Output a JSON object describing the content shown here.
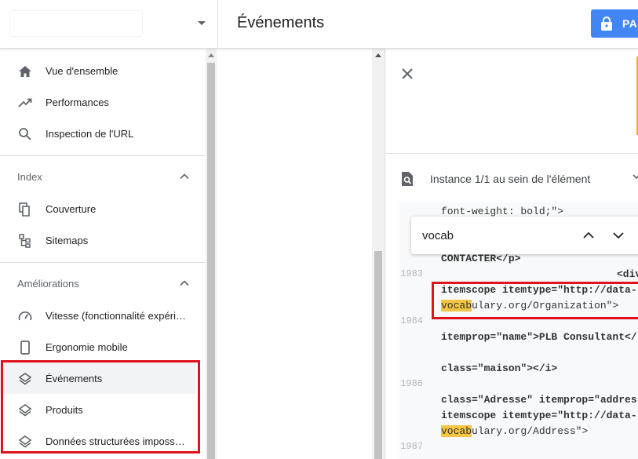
{
  "header": {
    "property_selector_value": "",
    "title": "Événements",
    "premium_label": "PA"
  },
  "sidebar": {
    "items_top": [
      {
        "label": "Vue d'ensemble",
        "icon": "home-icon"
      },
      {
        "label": "Performances",
        "icon": "trending-up-icon"
      },
      {
        "label": "Inspection de l'URL",
        "icon": "search-icon"
      }
    ],
    "sections": [
      {
        "title": "Index",
        "items": [
          {
            "label": "Couverture",
            "icon": "copy-icon"
          },
          {
            "label": "Sitemaps",
            "icon": "sitemap-icon"
          }
        ]
      },
      {
        "title": "Améliorations",
        "items": [
          {
            "label": "Vitesse (fonctionnalité expérimentale)",
            "icon": "speed-icon"
          },
          {
            "label": "Ergonomie mobile",
            "icon": "phone-icon"
          },
          {
            "label": "Événements",
            "icon": "layers-icon",
            "active": true
          },
          {
            "label": "Produits",
            "icon": "layers-icon"
          },
          {
            "label": "Données structurées impossibles à analyser",
            "icon": "layers-icon"
          }
        ]
      }
    ]
  },
  "detail": {
    "instance_text": "Instance 1/1 au sein de l'élément",
    "search": {
      "value": "vocab"
    },
    "code_lines": [
      {
        "num": "",
        "text": "font-weight: bold;\">"
      },
      {
        "num": "",
        "text": "CONTACTER</p>"
      },
      {
        "num": "1983",
        "text": "<div"
      },
      {
        "num": "",
        "text": "itemscope itemtype=\"http://data-"
      },
      {
        "num": "",
        "text": "vocabulary.org/Organization\">"
      },
      {
        "num": "1984",
        "text": ""
      },
      {
        "num": "",
        "text": "itemprop=\"name\">PLB Consultant</"
      },
      {
        "num": "",
        "text": "class=\"maison\"></i>"
      },
      {
        "num": "1986",
        "text": ""
      },
      {
        "num": "",
        "text": "class=\"Adresse\" itemprop=\"addres"
      },
      {
        "num": "",
        "text": "itemscope itemtype=\"http://data-"
      },
      {
        "num": "",
        "text": "vocabulary.org/Address\">"
      },
      {
        "num": "1987",
        "text": ""
      }
    ]
  },
  "colors": {
    "accent": "#4285f4",
    "highlight_red": "#e0121b",
    "match_yellow": "#f4c542"
  }
}
